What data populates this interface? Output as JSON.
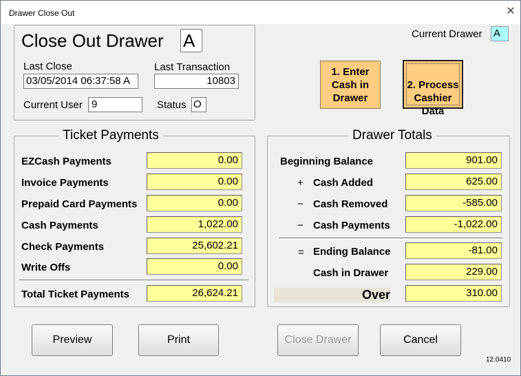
{
  "window": {
    "title": "Drawer Close Out",
    "version": "12.0410"
  },
  "header": {
    "heading": "Close Out Drawer",
    "drawer_id": "A",
    "last_close_label": "Last Close",
    "last_close_value": "03/05/2014 06:37:58 A",
    "last_transaction_label": "Last Transaction",
    "last_transaction_value": "10803",
    "current_user_label": "Current User",
    "current_user_value": "9",
    "status_label": "Status",
    "status_value": "O"
  },
  "current_drawer": {
    "label": "Current Drawer",
    "value": "A"
  },
  "actions": {
    "enter_cash": "1. Enter\nCash in\nDrawer",
    "process_cashier": "2. Process\nCashier\nData"
  },
  "ticket_payments": {
    "title": "Ticket Payments",
    "rows": [
      {
        "label": "EZCash Payments",
        "value": "0.00"
      },
      {
        "label": "Invoice Payments",
        "value": "0.00"
      },
      {
        "label": "Prepaid Card Payments",
        "value": "0.00"
      },
      {
        "label": "Cash Payments",
        "value": "1,022.00"
      },
      {
        "label": "Check Payments",
        "value": "25,602.21"
      },
      {
        "label": "Write Offs",
        "value": "0.00"
      }
    ],
    "total": {
      "label": "Total Ticket Payments",
      "value": "26,624.21"
    }
  },
  "drawer_totals": {
    "title": "Drawer Totals",
    "rows": [
      {
        "sym": "",
        "label": "Beginning Balance",
        "value": "901.00"
      },
      {
        "sym": "+",
        "label": "Cash Added",
        "value": "625.00"
      },
      {
        "sym": "−",
        "label": "Cash Removed",
        "value": "-585.00"
      },
      {
        "sym": "−",
        "label": "Cash Payments",
        "value": "-1,022.00"
      }
    ],
    "ending": {
      "sym": "=",
      "label": "Ending Balance",
      "value": "-81.00"
    },
    "cash_in_drawer": {
      "label": "Cash in Drawer",
      "value": "229.00"
    },
    "over": {
      "label": "Over",
      "value": "310.00"
    }
  },
  "buttons": {
    "preview": "Preview",
    "print": "Print",
    "close_drawer": "Close Drawer",
    "cancel": "Cancel"
  }
}
